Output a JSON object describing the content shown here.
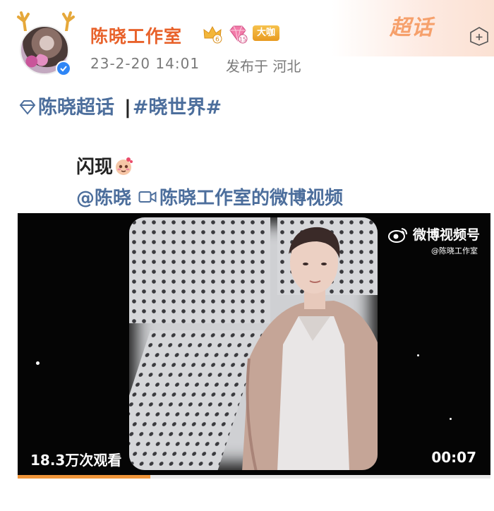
{
  "header": {
    "username": "陈晓工作室",
    "badge_level_crown": "6",
    "badge_level_diamond": "15",
    "badge_vip": "大咖",
    "time": "23-2-20 14:01",
    "location": "发布于 河北",
    "supertopic_mark": "超话"
  },
  "post": {
    "topic_supertopic": "陈晓超话",
    "topic_separator": "|",
    "hashtag": "#晓世界#",
    "text": "闪现",
    "mention": "@陈晓",
    "video_link": "陈晓工作室的微博视频"
  },
  "video": {
    "watermark_title": "微博视频号",
    "watermark_sub": "@陈晓工作室",
    "views": "18.3万次观看",
    "duration": "00:07",
    "progress": 0.28
  },
  "colors": {
    "username": "#e8622b",
    "link": "#4c6e9c",
    "progress": "#f0953a"
  },
  "icons": [
    "antler-icon",
    "verified-icon",
    "crown-badge-icon",
    "diamond-badge-icon",
    "more-icon",
    "supertopic-gem-icon",
    "emoji-icon",
    "video-camera-icon",
    "weibo-logo-icon"
  ]
}
